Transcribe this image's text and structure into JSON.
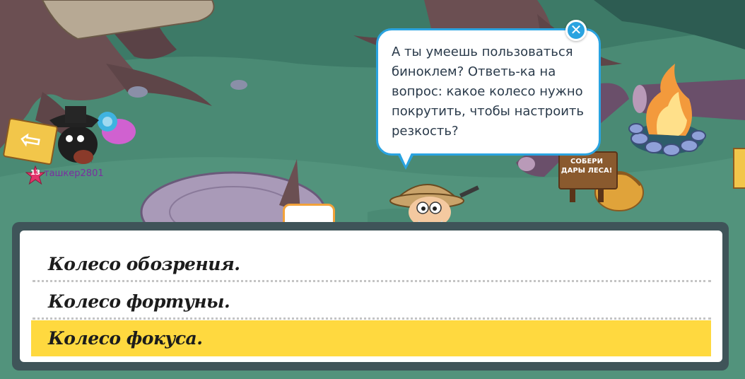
{
  "dialog": {
    "question": "А ты умеешь пользоваться\nбиноклем? Ответь-ка на\nвопрос: какое колесо нужно\nпокрутить, чтобы настроить\nрезкость?",
    "close_icon": "close-icon"
  },
  "answers": [
    {
      "label": "Колесо обозрения.",
      "selected": false
    },
    {
      "label": "Колесо фортуны.",
      "selected": false
    },
    {
      "label": "Колесо фокуса.",
      "selected": true
    }
  ],
  "scene": {
    "player_level": "13",
    "player_name": "ташкер2801",
    "sign_text": "СОБЕРИ\nДАРЫ ЛЕСА!",
    "selected_color": "#ffd93f",
    "bubble_border_color": "#2aa3e0"
  }
}
